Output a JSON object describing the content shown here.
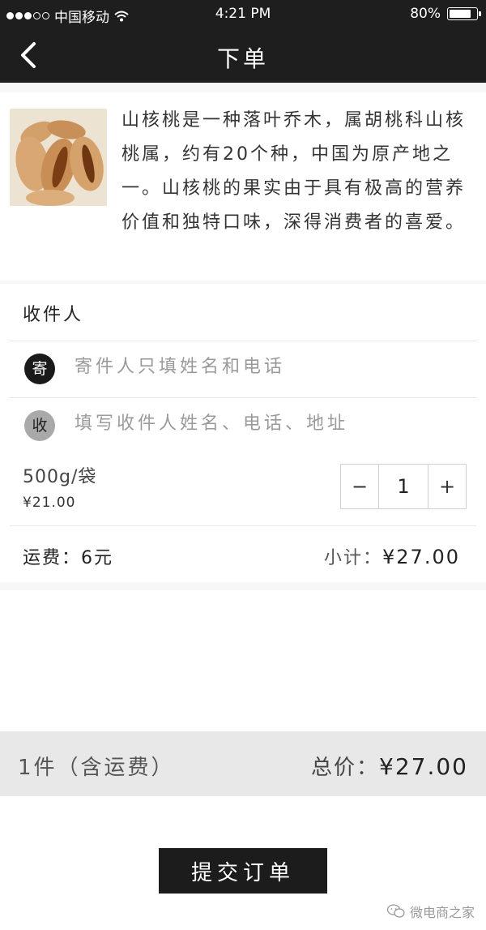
{
  "status_bar": {
    "carrier": "中国移动",
    "time": "4:21 PM",
    "battery_text": "80%",
    "battery_level": 0.8,
    "signal_icon": "signal-dots-icon",
    "wifi_icon": "wifi-icon"
  },
  "nav": {
    "title": "下单",
    "back_icon": "chevron-left-icon"
  },
  "product": {
    "image_icon": "pecan-photo",
    "description": "山核桃是一种落叶乔木，属胡桃科山核桃属，约有20个种，中国为原产地之一。山核桃的果实由于具有极高的营养价值和独特口味，深得消费者的喜爱。"
  },
  "recipient": {
    "section_title": "收件人",
    "sender_badge": "寄",
    "sender_placeholder": "寄件人只填姓名和电话",
    "receiver_badge": "收",
    "receiver_placeholder": "填写收件人姓名、电话、地址"
  },
  "item": {
    "unit": "500g/袋",
    "price": "¥21.00",
    "quantity": "1",
    "minus": "−",
    "plus": "+"
  },
  "fees": {
    "shipping": "运费：6元",
    "subtotal_label": "小计：",
    "subtotal_value": "¥27.00"
  },
  "total_bar": {
    "count": "1件（含运费）",
    "total_label": "总价：",
    "total_value": "¥27.00"
  },
  "submit_label": "提交订单",
  "watermark": "微电商之家",
  "colors": {
    "header": "#1e1e1e",
    "button": "#1c1c1c",
    "total_bar": "#e8e8e8"
  }
}
